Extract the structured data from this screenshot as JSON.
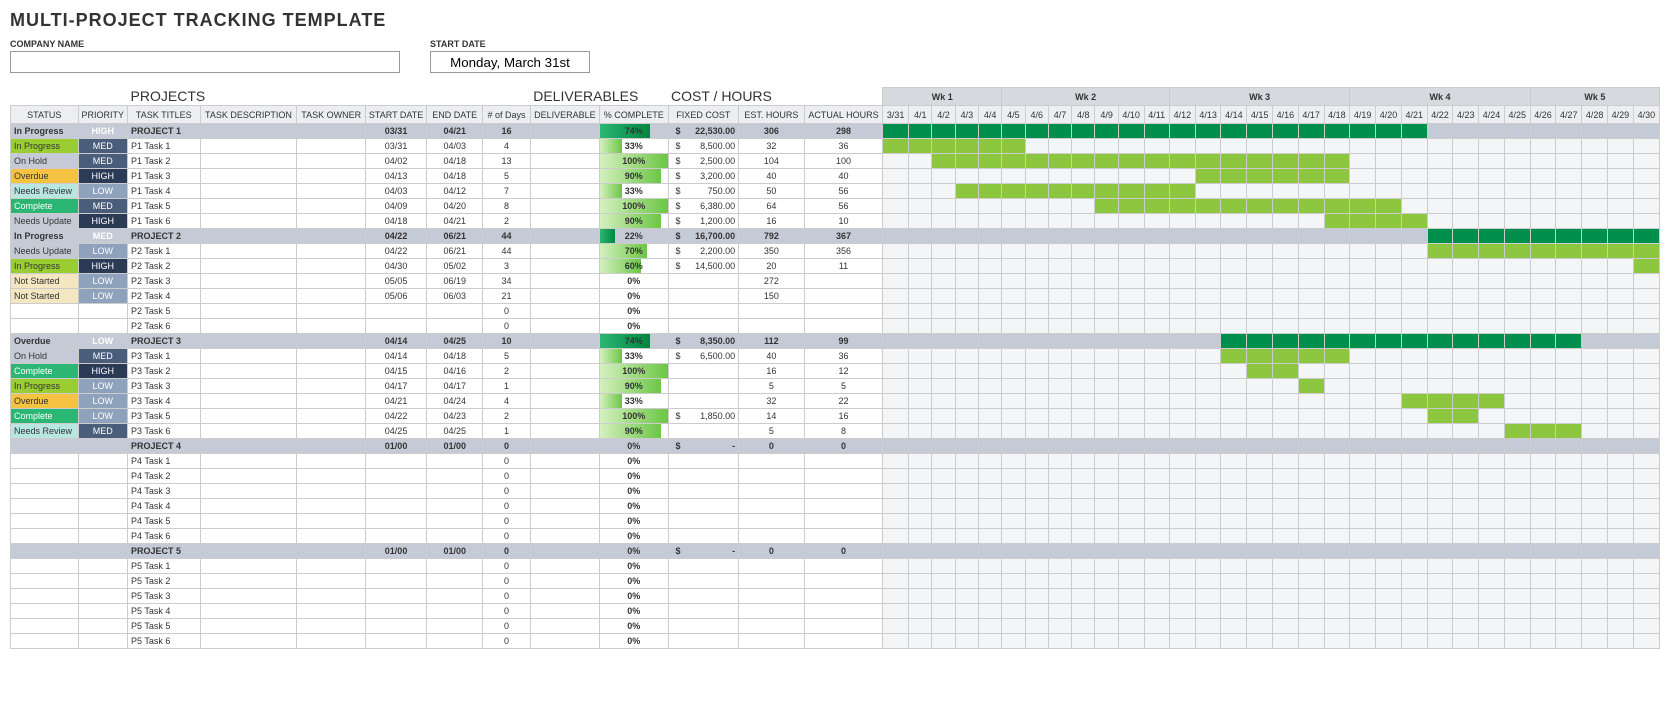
{
  "title": "MULTI-PROJECT TRACKING TEMPLATE",
  "labels": {
    "company": "COMPANY NAME",
    "startdate": "START DATE",
    "startdate_val": "Monday, March 31st",
    "projects": "PROJECTS",
    "deliverables": "DELIVERABLES",
    "costhours": "COST / HOURS"
  },
  "cols": {
    "status": "STATUS",
    "priority": "PRIORITY",
    "task": "TASK TITLES",
    "desc": "TASK DESCRIPTION",
    "owner": "TASK OWNER",
    "sdate": "START DATE",
    "edate": "END DATE",
    "days": "# of Days",
    "deliv": "DELIVERABLE",
    "pct": "% COMPLETE",
    "fcost": "FIXED COST",
    "ehrs": "EST. HOURS",
    "ahrs": "ACTUAL HOURS"
  },
  "weeks": [
    "Wk 1",
    "Wk 2",
    "Wk 3",
    "Wk 4",
    "Wk 5"
  ],
  "days": [
    "3/31",
    "4/1",
    "4/2",
    "4/3",
    "4/4",
    "4/5",
    "4/6",
    "4/7",
    "4/8",
    "4/9",
    "4/10",
    "4/11",
    "4/12",
    "4/13",
    "4/14",
    "4/15",
    "4/16",
    "4/17",
    "4/18",
    "4/19",
    "4/20",
    "4/21",
    "4/22",
    "4/23",
    "4/24",
    "4/25",
    "4/26",
    "4/27",
    "4/28",
    "4/29",
    "4/30"
  ],
  "rows": [
    {
      "proj": true,
      "status": "In Progress",
      "stc": "inprogress",
      "pri": "HIGH",
      "pc": "high",
      "title": "PROJECT 1",
      "sdate": "03/31",
      "edate": "04/21",
      "days": "16",
      "pct": 74,
      "fcost": "22,530.00",
      "ehrs": "306",
      "ahrs": "298",
      "g": [
        0,
        21,
        "dark"
      ]
    },
    {
      "status": "In Progress",
      "stc": "inprogress",
      "pri": "MED",
      "pc": "med",
      "title": "P1 Task 1",
      "sdate": "03/31",
      "edate": "04/03",
      "days": "4",
      "pct": 33,
      "fcost": "8,500.00",
      "ehrs": "32",
      "ahrs": "36",
      "g": [
        0,
        5
      ]
    },
    {
      "status": "On Hold",
      "stc": "onhold",
      "pri": "MED",
      "pc": "med",
      "title": "P1 Task 2",
      "sdate": "04/02",
      "edate": "04/18",
      "days": "13",
      "pct": 100,
      "fcost": "2,500.00",
      "ehrs": "104",
      "ahrs": "100",
      "g": [
        2,
        18
      ]
    },
    {
      "status": "Overdue",
      "stc": "overdue",
      "pri": "HIGH",
      "pc": "high",
      "title": "P1 Task 3",
      "sdate": "04/13",
      "edate": "04/18",
      "days": "5",
      "pct": 90,
      "fcost": "3,200.00",
      "ehrs": "40",
      "ahrs": "40",
      "g": [
        13,
        18
      ]
    },
    {
      "status": "Needs Review",
      "stc": "needsreview",
      "pri": "LOW",
      "pc": "low",
      "title": "P1 Task 4",
      "sdate": "04/03",
      "edate": "04/12",
      "days": "7",
      "pct": 33,
      "fcost": "750.00",
      "ehrs": "50",
      "ahrs": "56",
      "g": [
        3,
        12
      ]
    },
    {
      "status": "Complete",
      "stc": "complete",
      "pri": "MED",
      "pc": "med",
      "title": "P1 Task 5",
      "sdate": "04/09",
      "edate": "04/20",
      "days": "8",
      "pct": 100,
      "fcost": "6,380.00",
      "ehrs": "64",
      "ahrs": "56",
      "g": [
        9,
        20
      ]
    },
    {
      "status": "Needs Update",
      "stc": "needsupdate",
      "pri": "HIGH",
      "pc": "high",
      "title": "P1 Task 6",
      "sdate": "04/18",
      "edate": "04/21",
      "days": "2",
      "pct": 90,
      "fcost": "1,200.00",
      "ehrs": "16",
      "ahrs": "10",
      "g": [
        18,
        21
      ]
    },
    {
      "proj": true,
      "status": "In Progress",
      "stc": "inprogress",
      "pri": "MED",
      "pc": "med",
      "title": "PROJECT 2",
      "sdate": "04/22",
      "edate": "06/21",
      "days": "44",
      "pct": 22,
      "fcost": "16,700.00",
      "ehrs": "792",
      "ahrs": "367",
      "g": [
        22,
        31,
        "dark"
      ]
    },
    {
      "status": "Needs Update",
      "stc": "needsupdate",
      "pri": "LOW",
      "pc": "low",
      "title": "P2 Task 1",
      "sdate": "04/22",
      "edate": "06/21",
      "days": "44",
      "pct": 70,
      "fcost": "2,200.00",
      "ehrs": "350",
      "ahrs": "356",
      "g": [
        22,
        31
      ]
    },
    {
      "status": "In Progress",
      "stc": "inprogress",
      "pri": "HIGH",
      "pc": "high",
      "title": "P2 Task 2",
      "sdate": "04/30",
      "edate": "05/02",
      "days": "3",
      "pct": 60,
      "fcost": "14,500.00",
      "ehrs": "20",
      "ahrs": "11",
      "g": [
        30,
        31
      ]
    },
    {
      "status": "Not Started",
      "stc": "notstarted",
      "pri": "LOW",
      "pc": "low",
      "title": "P2 Task 3",
      "sdate": "05/05",
      "edate": "06/19",
      "days": "34",
      "pct": 0,
      "ehrs": "272"
    },
    {
      "status": "Not Started",
      "stc": "notstarted",
      "pri": "LOW",
      "pc": "low",
      "title": "P2 Task 4",
      "sdate": "05/06",
      "edate": "06/03",
      "days": "21",
      "pct": 0,
      "ehrs": "150"
    },
    {
      "title": "P2 Task 5",
      "days": "0",
      "pct": 0
    },
    {
      "title": "P2 Task 6",
      "days": "0",
      "pct": 0
    },
    {
      "proj": true,
      "status": "Overdue",
      "stc": "overdue",
      "pri": "LOW",
      "pc": "low",
      "title": "PROJECT 3",
      "sdate": "04/14",
      "edate": "04/25",
      "days": "10",
      "pct": 74,
      "fcost": "8,350.00",
      "ehrs": "112",
      "ahrs": "99",
      "g": [
        14,
        27,
        "dark"
      ]
    },
    {
      "status": "On Hold",
      "stc": "onhold",
      "pri": "MED",
      "pc": "med",
      "title": "P3 Task 1",
      "sdate": "04/14",
      "edate": "04/18",
      "days": "5",
      "pct": 33,
      "fcost": "6,500.00",
      "ehrs": "40",
      "ahrs": "36",
      "g": [
        14,
        18
      ]
    },
    {
      "status": "Complete",
      "stc": "complete",
      "pri": "HIGH",
      "pc": "high",
      "title": "P3 Task 2",
      "sdate": "04/15",
      "edate": "04/16",
      "days": "2",
      "pct": 100,
      "ehrs": "16",
      "ahrs": "12",
      "g": [
        15,
        16
      ]
    },
    {
      "status": "In Progress",
      "stc": "inprogress",
      "pri": "LOW",
      "pc": "low",
      "title": "P3 Task 3",
      "sdate": "04/17",
      "edate": "04/17",
      "days": "1",
      "pct": 90,
      "ehrs": "5",
      "ahrs": "5",
      "g": [
        17,
        17
      ]
    },
    {
      "status": "Overdue",
      "stc": "overdue",
      "pri": "LOW",
      "pc": "low",
      "title": "P3 Task 4",
      "sdate": "04/21",
      "edate": "04/24",
      "days": "4",
      "pct": 33,
      "ehrs": "32",
      "ahrs": "22",
      "g": [
        21,
        24
      ]
    },
    {
      "status": "Complete",
      "stc": "complete",
      "pri": "LOW",
      "pc": "low",
      "title": "P3 Task 5",
      "sdate": "04/22",
      "edate": "04/23",
      "days": "2",
      "pct": 100,
      "fcost": "1,850.00",
      "ehrs": "14",
      "ahrs": "16",
      "g": [
        22,
        23
      ]
    },
    {
      "status": "Needs Review",
      "stc": "needsreview",
      "pri": "MED",
      "pc": "med",
      "title": "P3 Task 6",
      "sdate": "04/25",
      "edate": "04/25",
      "days": "1",
      "pct": 90,
      "ehrs": "5",
      "ahrs": "8",
      "g": [
        25,
        27
      ]
    },
    {
      "proj": true,
      "title": "PROJECT 4",
      "sdate": "01/00",
      "edate": "01/00",
      "days": "0",
      "pct": 0,
      "fcost": "-",
      "ehrs": "0",
      "ahrs": "0"
    },
    {
      "title": "P4 Task 1",
      "days": "0",
      "pct": 0
    },
    {
      "title": "P4 Task 2",
      "days": "0",
      "pct": 0
    },
    {
      "title": "P4 Task 3",
      "days": "0",
      "pct": 0
    },
    {
      "title": "P4 Task 4",
      "days": "0",
      "pct": 0
    },
    {
      "title": "P4 Task 5",
      "days": "0",
      "pct": 0
    },
    {
      "title": "P4 Task 6",
      "days": "0",
      "pct": 0
    },
    {
      "proj": true,
      "title": "PROJECT 5",
      "sdate": "01/00",
      "edate": "01/00",
      "days": "0",
      "pct": 0,
      "fcost": "-",
      "ehrs": "0",
      "ahrs": "0"
    },
    {
      "title": "P5 Task 1",
      "days": "0",
      "pct": 0
    },
    {
      "title": "P5 Task 2",
      "days": "0",
      "pct": 0
    },
    {
      "title": "P5 Task 3",
      "days": "0",
      "pct": 0
    },
    {
      "title": "P5 Task 4",
      "days": "0",
      "pct": 0
    },
    {
      "title": "P5 Task 5",
      "days": "0",
      "pct": 0
    },
    {
      "title": "P5 Task 6",
      "days": "0",
      "pct": 0
    }
  ]
}
